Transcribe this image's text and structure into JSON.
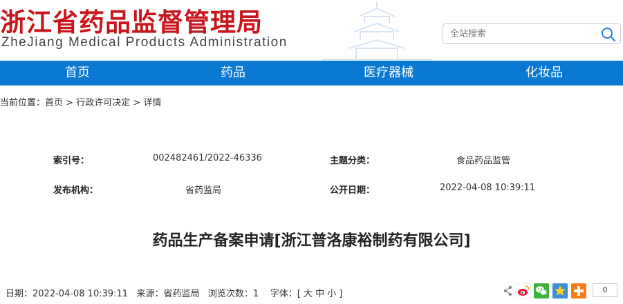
{
  "header": {
    "logo_cn": "浙江省药品监督管理局",
    "logo_en": "ZheJiang Medical Products Administration",
    "search_placeholder": "全站搜索"
  },
  "nav": {
    "items": [
      {
        "label": "首页"
      },
      {
        "label": "药品"
      },
      {
        "label": "医疗器械"
      },
      {
        "label": "化妆品"
      }
    ]
  },
  "breadcrumb": {
    "prefix": "当前位置：",
    "items": [
      "首页",
      "行政许可决定",
      "详情"
    ],
    "sep": " > "
  },
  "meta": {
    "index_label": "索引号：",
    "index_value": "002482461/2022-46336",
    "topic_label": "主题分类：",
    "topic_value": "食品药品监管",
    "publisher_label": "发布机构：",
    "publisher_value": "省药监局",
    "date_label": "公开日期：",
    "date_value": "2022-04-08 10:39:11"
  },
  "article": {
    "title": "药品生产备案申请[浙江普洛康裕制药有限公司]"
  },
  "info_bar": {
    "date": "日期：2022-04-08 10:39:11",
    "source": "来源：省药监局",
    "views": "浏览次数：1",
    "font_label": "字体：[",
    "font_large": "大",
    "font_medium": "中",
    "font_small": "小",
    "font_close": "]",
    "share_count": "0"
  },
  "colors": {
    "brand_red": "#c8161d",
    "nav_blue": "#0b78d1"
  },
  "icons": [
    "search-icon",
    "share-icon",
    "weibo-icon",
    "wechat-icon",
    "qzone-icon",
    "more-share-icon"
  ]
}
